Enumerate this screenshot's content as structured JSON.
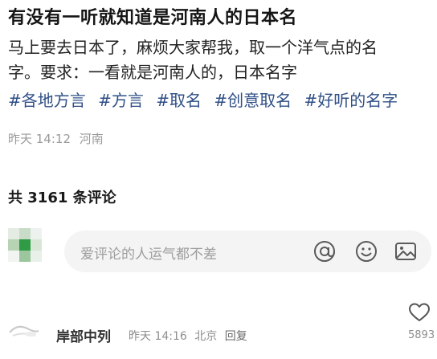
{
  "post": {
    "title": "有没有一听就知道是河南人的日本名",
    "body_line1": "马上要去日本了，麻烦大家帮我，取一个洋气点的名",
    "body_line2": "字。要求：一看就是河南人的，日本名字",
    "tags": [
      "#各地方言",
      "#方言",
      "#取名",
      "#创意取名",
      "#好听的名字"
    ],
    "meta": {
      "date": "昨天 14:12",
      "location": "河南"
    }
  },
  "comments_header": {
    "count_label": "共 3161 条评论"
  },
  "comment_input": {
    "placeholder": "爱评论的人运气都不差",
    "icons": [
      "at-icon",
      "emoji-icon",
      "image-icon"
    ]
  },
  "first_comment": {
    "author": "岸部中列",
    "time": "昨天 14:16",
    "location": "北京",
    "reply_label": "回复",
    "like_count": "5893",
    "like_icon": "heart-outline-icon"
  },
  "colors": {
    "tag": "#2f4f86",
    "meta": "#9a9a9a",
    "input_bg": "#f4f4f5"
  }
}
